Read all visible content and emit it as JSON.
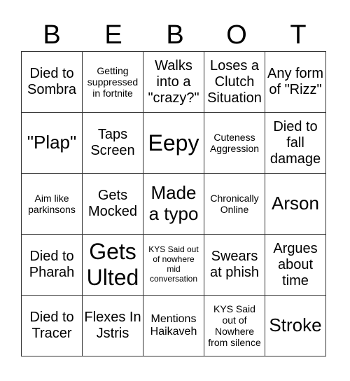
{
  "header": [
    "B",
    "E",
    "B",
    "O",
    "T"
  ],
  "cells": [
    [
      "Died to Sombra",
      "Getting suppressed in fortnite",
      "Walks into a \"crazy?\"",
      "Loses a Clutch Situation",
      "Any form of \"Rizz\""
    ],
    [
      "\"Plap\"",
      "Taps Screen",
      "Eepy",
      "Cuteness Aggression",
      "Died to fall damage"
    ],
    [
      "Aim like parkinsons",
      "Gets Mocked",
      "Made a typo",
      "Chronically Online",
      "Arson"
    ],
    [
      "Died to Pharah",
      "Gets Ulted",
      "KYS Said out of nowhere mid conversation",
      "Swears at phish",
      "Argues about time"
    ],
    [
      "Died to Tracer",
      "Flexes In Jstris",
      "Mentions Haikaveh",
      "KYS Said out of Nowhere from silence",
      "Stroke"
    ]
  ]
}
